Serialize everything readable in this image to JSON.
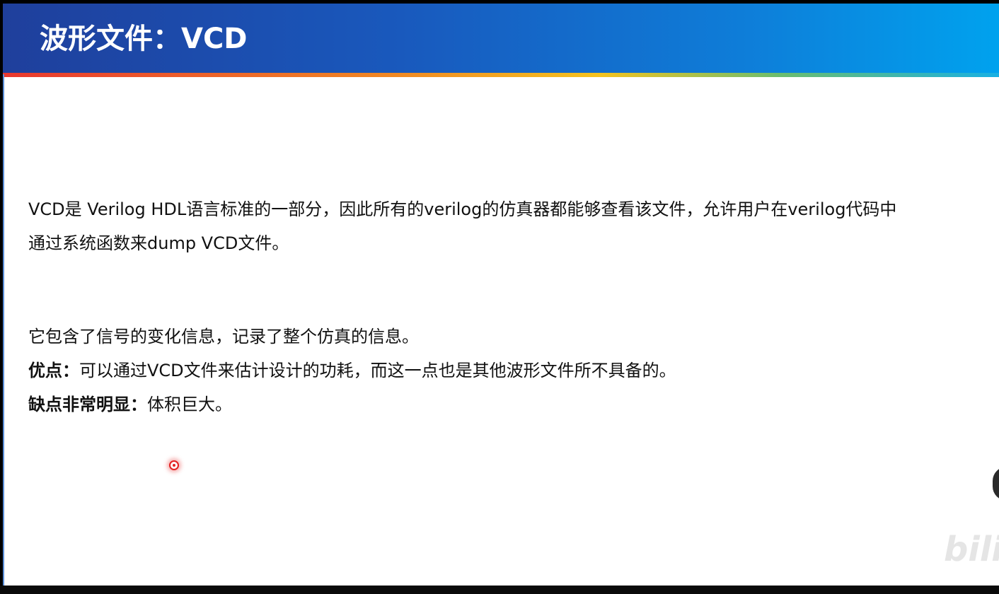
{
  "slide": {
    "title": "波形文件：VCD",
    "paragraph1": {
      "line1": "VCD是 Verilog HDL语言标准的一部分，因此所有的verilog的仿真器都能够查看该文件，允许用户在verilog代码中",
      "line2": "通过系统函数来dump VCD文件。"
    },
    "paragraph2": {
      "line1": "它包含了信号的变化信息，记录了整个仿真的信息。",
      "advantage_label": "优点：",
      "advantage_text": "可以通过VCD文件来估计设计的功耗，而这一点也是其他波形文件所不具备的。",
      "disadvantage_label": "缺点非常明显：",
      "disadvantage_text": "体积巨大。"
    }
  },
  "watermark": "bilib",
  "colors": {
    "title_bar_start": "#1f3f9c",
    "title_bar_end": "#00a2ee",
    "laser": "#e32222"
  }
}
